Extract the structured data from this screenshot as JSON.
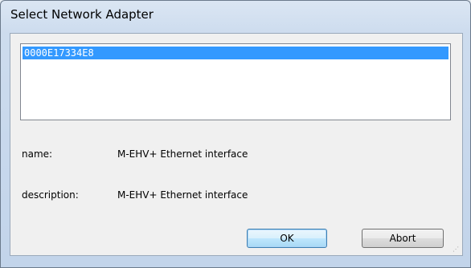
{
  "window": {
    "title": "Select Network Adapter"
  },
  "adapter_list": {
    "items": [
      "0000E17334E8"
    ],
    "selected_index": 0
  },
  "details": {
    "name_label": "name:",
    "name_value": "M-EHV+  Ethernet interface",
    "description_label": "description:",
    "description_value": "M-EHV+  Ethernet interface"
  },
  "buttons": {
    "ok_label": "OK",
    "abort_label": "Abort"
  },
  "icons": {
    "resize_grip": "resize-grip-icon"
  },
  "colors": {
    "selection": "#3399ff",
    "dialog_background": "#f0f0f0"
  }
}
